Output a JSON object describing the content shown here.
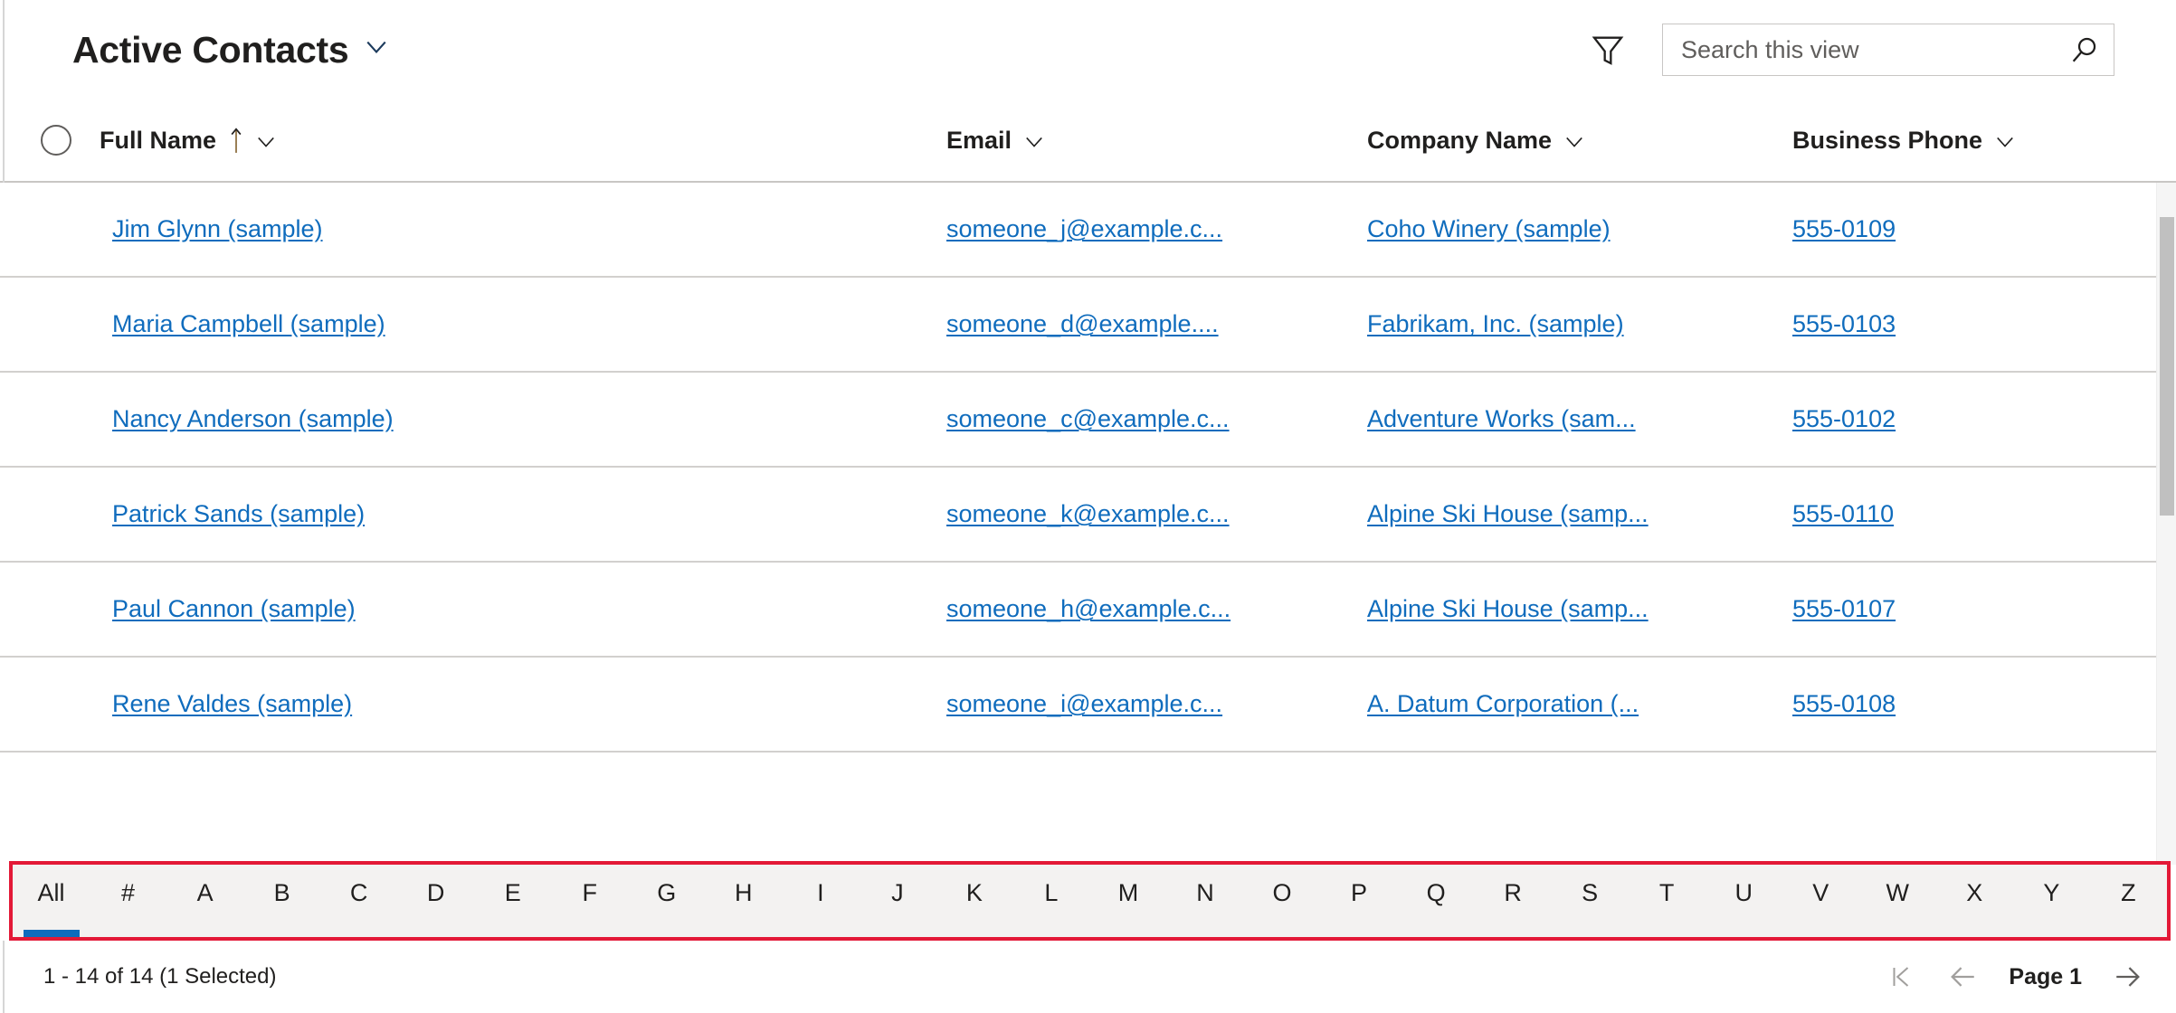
{
  "header": {
    "view_title": "Active Contacts",
    "view_chevron_icon": "chevron-down-icon",
    "filter_icon": "filter-funnel-icon",
    "search": {
      "placeholder": "Search this view",
      "value": "",
      "icon": "search-icon"
    }
  },
  "grid": {
    "select_all_icon": "select-all-circle-icon",
    "columns": [
      {
        "label": "Full Name",
        "sorted": "asc",
        "sort_icon": "sort-ascending-arrow-icon",
        "menu_icon": "chevron-down-icon"
      },
      {
        "label": "Email",
        "sorted": "",
        "menu_icon": "chevron-down-icon"
      },
      {
        "label": "Company Name",
        "sorted": "",
        "menu_icon": "chevron-down-icon"
      },
      {
        "label": "Business Phone",
        "sorted": "",
        "menu_icon": "chevron-down-icon"
      }
    ],
    "rows": [
      {
        "full_name": "Jim Glynn (sample)",
        "email": "someone_j@example.c...",
        "company": "Coho Winery (sample)",
        "phone": "555-0109"
      },
      {
        "full_name": "Maria Campbell (sample)",
        "email": "someone_d@example....",
        "company": "Fabrikam, Inc. (sample)",
        "phone": "555-0103"
      },
      {
        "full_name": "Nancy Anderson (sample)",
        "email": "someone_c@example.c...",
        "company": "Adventure Works (sam...",
        "phone": "555-0102"
      },
      {
        "full_name": "Patrick Sands (sample)",
        "email": "someone_k@example.c...",
        "company": "Alpine Ski House (samp...",
        "phone": "555-0110"
      },
      {
        "full_name": "Paul Cannon (sample)",
        "email": "someone_h@example.c...",
        "company": "Alpine Ski House (samp...",
        "phone": "555-0107"
      },
      {
        "full_name": "Rene Valdes (sample)",
        "email": "someone_i@example.c...",
        "company": "A. Datum Corporation (...",
        "phone": "555-0108"
      }
    ],
    "scrollbar": {
      "name": "vertical-scrollbar"
    }
  },
  "alpha_filter": {
    "highlight_color": "#e31937",
    "active_color": "#0f6cbd",
    "active": "All",
    "items": [
      "All",
      "#",
      "A",
      "B",
      "C",
      "D",
      "E",
      "F",
      "G",
      "H",
      "I",
      "J",
      "K",
      "L",
      "M",
      "N",
      "O",
      "P",
      "Q",
      "R",
      "S",
      "T",
      "U",
      "V",
      "W",
      "X",
      "Y",
      "Z"
    ]
  },
  "footer": {
    "status": "1 - 14 of 14 (1 Selected)",
    "pager": {
      "first_icon": "page-first-icon",
      "prev_icon": "arrow-left-icon",
      "page_label": "Page 1",
      "next_icon": "arrow-right-icon"
    }
  },
  "colors": {
    "link": "#0f6cbd",
    "text": "#201f1e",
    "row_divider": "#d2d0ce",
    "header_divider": "#c8c6c4",
    "alpha_bar_bg": "#f3f2f1",
    "highlight": "#e31937"
  }
}
